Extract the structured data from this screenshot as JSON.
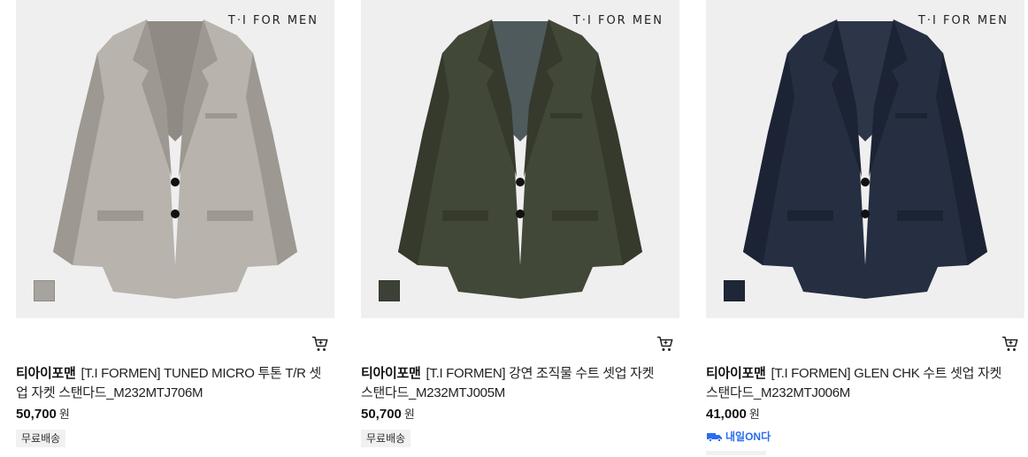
{
  "products": [
    {
      "watermark": "T·I FOR MEN",
      "swatch_color": "#a7a39e",
      "jacket_color": "#b8b3ad",
      "jacket_shade": "#9d9891",
      "lining_color": "#8f8a84",
      "brand": "티아이포맨",
      "title_line1": "[T.I FORMEN] TUNED MICRO 투톤 T/R 셋",
      "title_line2": "업 자켓 스탠다드_M232MTJ706M",
      "price": "50,700",
      "currency": "원",
      "badge": "무료배송",
      "cart_icon": "cart-icon"
    },
    {
      "watermark": "T·I FOR MEN",
      "swatch_color": "#3c4137",
      "jacket_color": "#424838",
      "jacket_shade": "#353a2d",
      "lining_color": "#4e5a5c",
      "brand": "티아이포맨",
      "title_line1": "[T.I FORMEN] 강연 조직물 수트 셋업 자켓",
      "title_line2": "스탠다드_M232MTJ005M",
      "price": "50,700",
      "currency": "원",
      "badge": "무료배송",
      "cart_icon": "cart-icon"
    },
    {
      "watermark": "T·I FOR MEN",
      "swatch_color": "#1e2638",
      "jacket_color": "#262e42",
      "jacket_shade": "#1c2334",
      "lining_color": "#2d3548",
      "brand": "티아이포맨",
      "title_line1": "[T.I FORMEN] GLEN CHK 수트 셋업 자켓",
      "title_line2": "스탠다드_M232MTJ006M",
      "price": "41,000",
      "currency": "원",
      "badge": "내일ON다",
      "cart_icon": "cart-icon"
    }
  ],
  "colors": {
    "accent_blue": "#2a6cf0"
  }
}
